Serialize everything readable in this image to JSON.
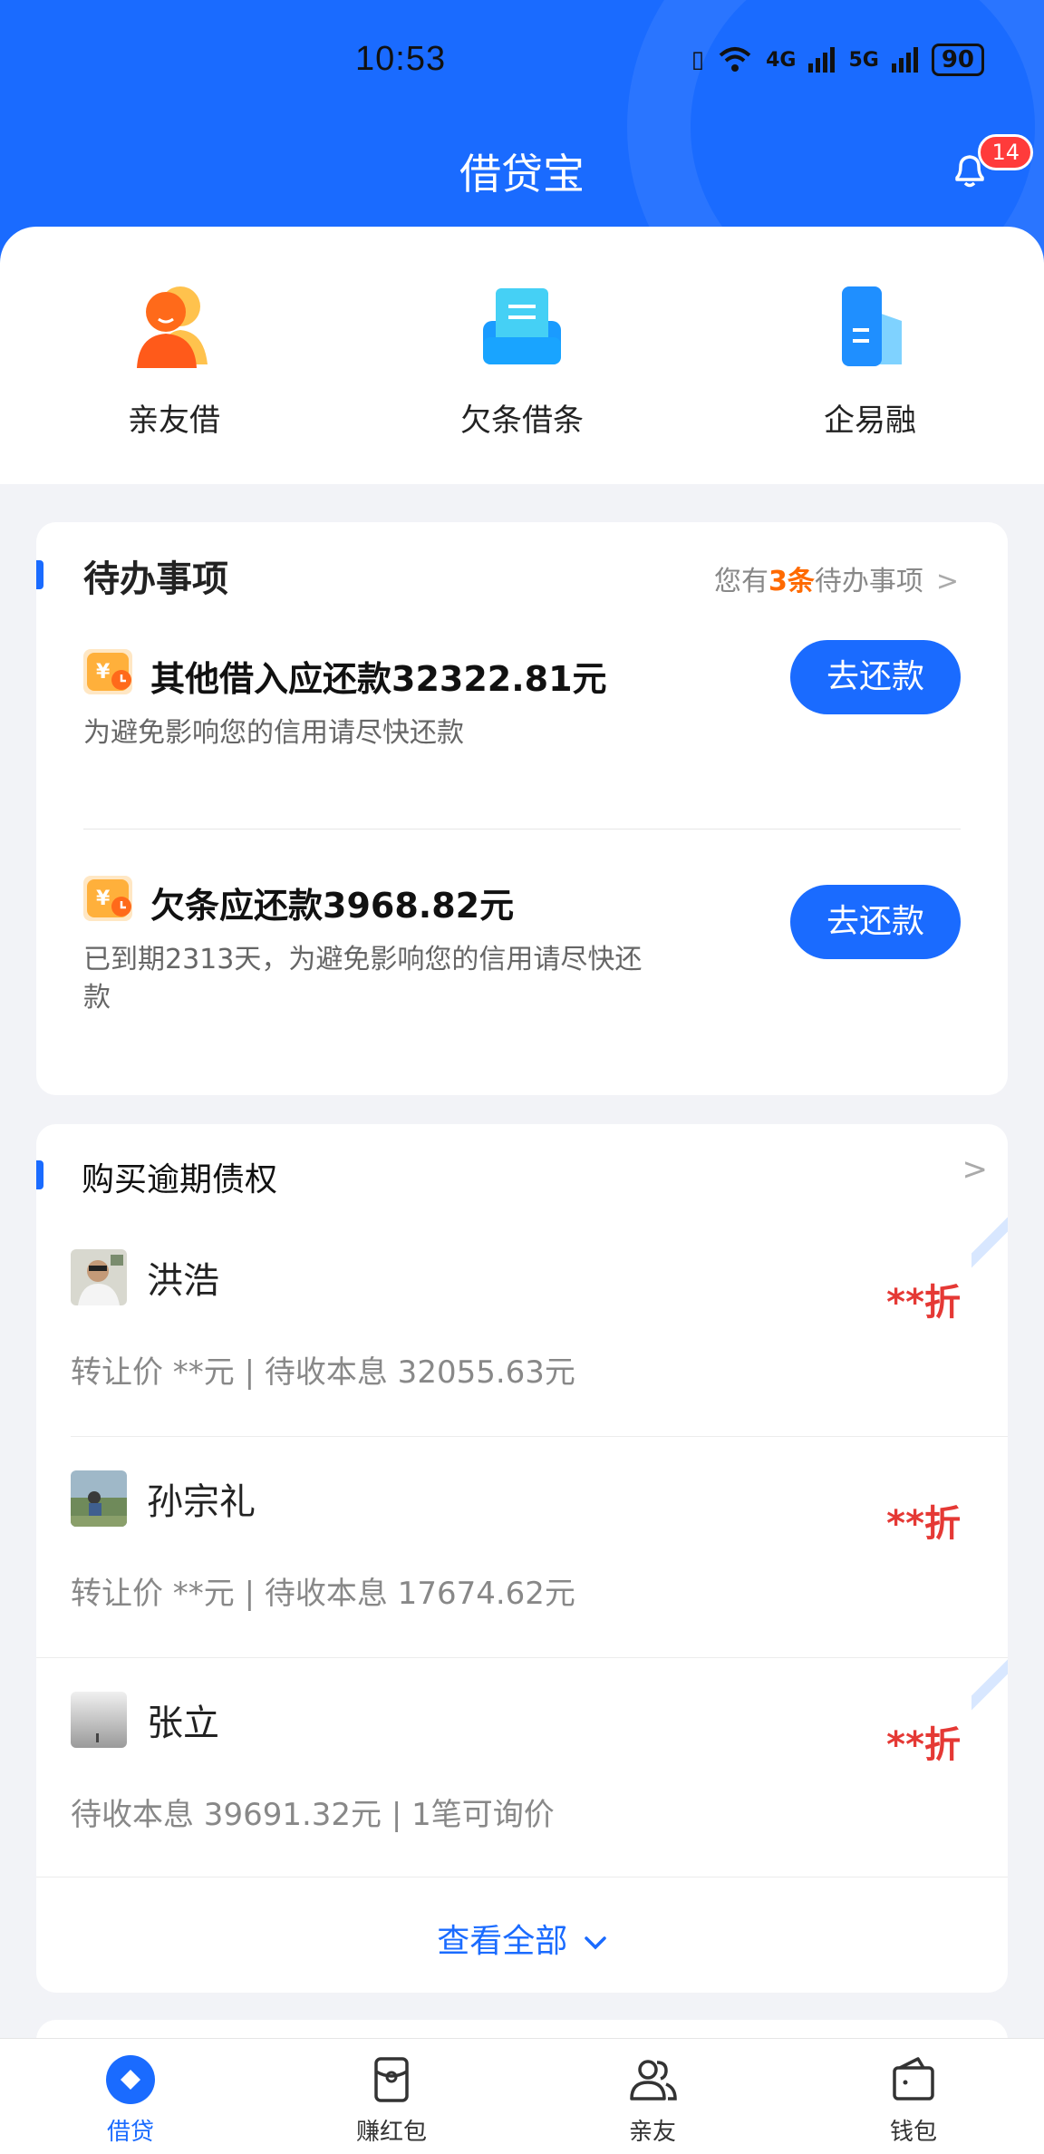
{
  "status_bar": {
    "time": "10:53",
    "network1": "4G",
    "network2": "5G",
    "battery": "90"
  },
  "header": {
    "title": "借贷宝",
    "notification_count": "14"
  },
  "quick_actions": [
    {
      "label": "亲友借",
      "icon": "friend-loan-icon"
    },
    {
      "label": "欠条借条",
      "icon": "iou-icon"
    },
    {
      "label": "企易融",
      "icon": "enterprise-finance-icon"
    }
  ],
  "todo": {
    "title": "待办事项",
    "summary_prefix": "您有",
    "summary_count": "3条",
    "summary_suffix": "待办事项",
    "tasks": [
      {
        "title": "其他借入应还款32322.81元",
        "desc": "为避免影响您的信用请尽快还款",
        "button": "去还款"
      },
      {
        "title": "欠条应还款3968.82元",
        "desc": "已到期2313天，为避免影响您的信用请尽快还款",
        "button": "去还款"
      }
    ]
  },
  "debt": {
    "title": "购买逾期债权",
    "items": [
      {
        "name": "洪浩",
        "discount": "**折",
        "info": "转让价 **元 | 待收本息 32055.63元"
      },
      {
        "name": "孙宗礼",
        "discount": "**折",
        "info": "转让价 **元 | 待收本息 17674.62元"
      },
      {
        "name": "张立",
        "discount": "**折",
        "info": "待收本息 39691.32元 | 1笔可询价"
      }
    ],
    "view_all": "查看全部"
  },
  "bottom_nav": [
    {
      "label": "借贷",
      "active": true
    },
    {
      "label": "赚红包",
      "active": false
    },
    {
      "label": "亲友",
      "active": false
    },
    {
      "label": "钱包",
      "active": false
    }
  ],
  "colors": {
    "primary": "#1a6bff",
    "discount_red": "#e53935",
    "highlight_orange": "#ff6a00"
  }
}
